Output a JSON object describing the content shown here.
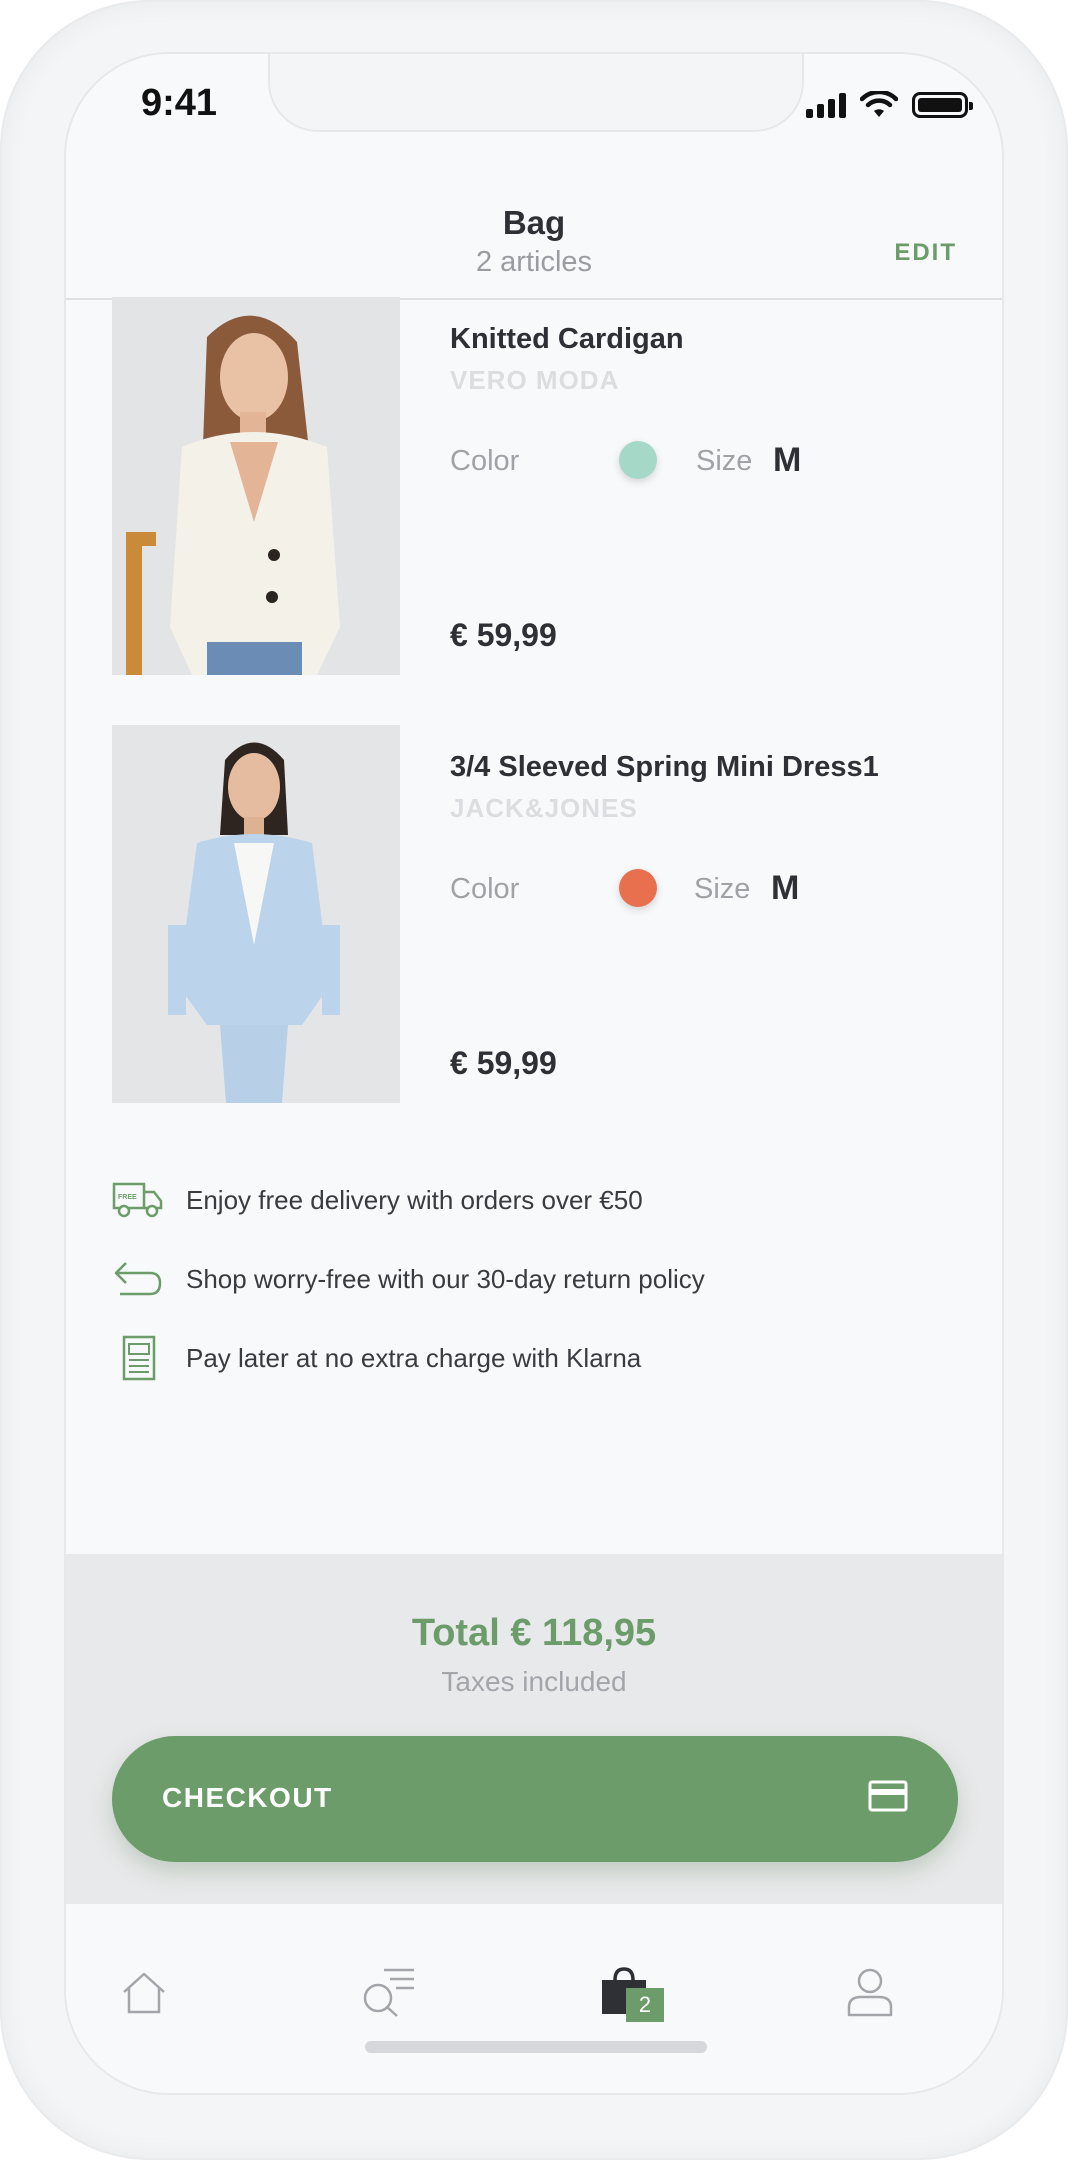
{
  "status": {
    "time": "9:41"
  },
  "header": {
    "title": "Bag",
    "subtitle": "2 articles",
    "edit_label": "EDIT"
  },
  "products": [
    {
      "name": "Knitted Cardigan",
      "brand": "VERO MODA",
      "color_label": "Color",
      "color": "#a6d8c8",
      "size_label": "Size",
      "size": "M",
      "price": "€ 59,99"
    },
    {
      "name": "3/4 Sleeved Spring Mini Dress1",
      "brand": "JACK&JONES",
      "color_label": "Color",
      "color": "#e8704e",
      "size_label": "Size",
      "size": "M",
      "price": "€ 59,99"
    }
  ],
  "perks": [
    {
      "icon": "delivery-truck-icon",
      "text": "Enjoy free delivery with orders over €50"
    },
    {
      "icon": "return-arrow-icon",
      "text": "Shop worry-free with our 30-day return policy"
    },
    {
      "icon": "receipt-icon",
      "text": "Pay later at no extra charge with Klarna"
    }
  ],
  "summary": {
    "total": "Total € 118,95",
    "taxes": "Taxes included"
  },
  "checkout": {
    "label": "CHECKOUT",
    "icon": "credit-card-icon"
  },
  "tabbar": {
    "tabs": [
      {
        "icon": "home-icon"
      },
      {
        "icon": "search-list-icon"
      },
      {
        "icon": "shopping-bag-icon",
        "badge": "2",
        "active": true
      },
      {
        "icon": "profile-icon"
      }
    ]
  },
  "colors": {
    "accent": "#6b9c6a",
    "text": "#2f3036",
    "muted": "#9a9ca2"
  }
}
